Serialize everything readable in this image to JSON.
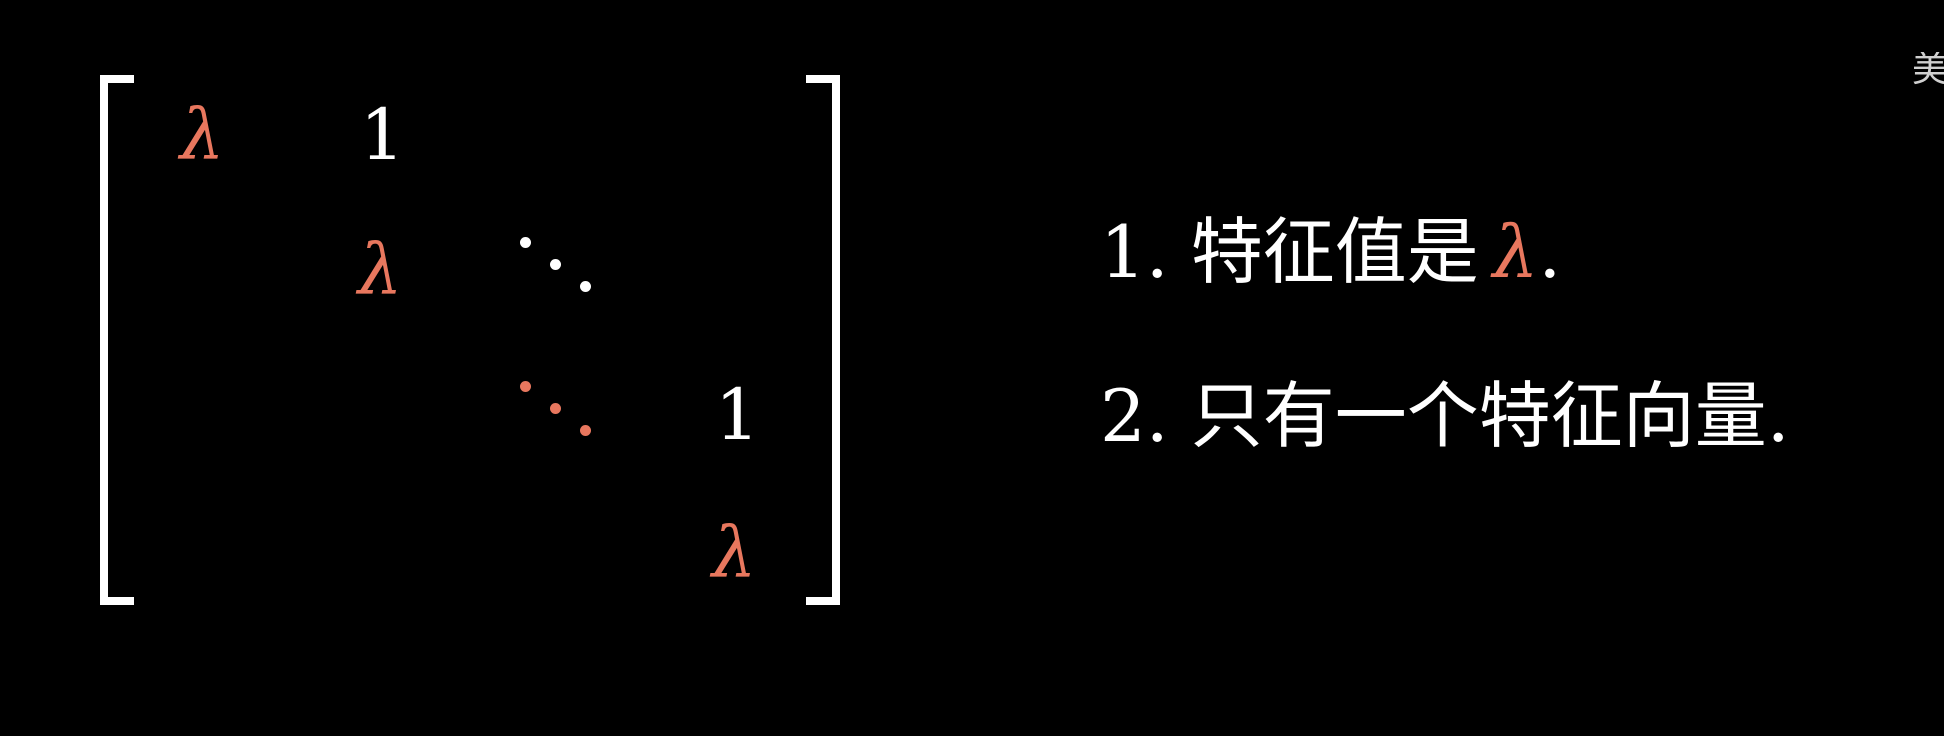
{
  "matrix": {
    "lambda_1": "λ",
    "one_1": "1",
    "lambda_2": "λ",
    "one_2": "1",
    "lambda_3": "λ",
    "accent_color": "#e8775e",
    "text_color": "#ffffff"
  },
  "statements": {
    "s1_num": "1.",
    "s1_text": "特征值是",
    "s1_symbol": "λ",
    "s1_end": ".",
    "s2_num": "2.",
    "s2_text": "只有一个特征向量."
  },
  "corner_glyph": "美"
}
